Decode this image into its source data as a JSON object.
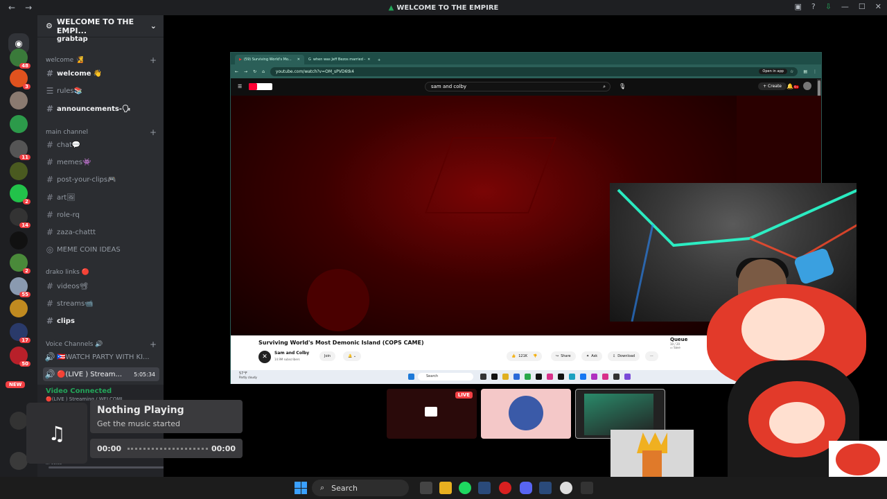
{
  "titlebar": {
    "title": "WELCOME TO THE EMPIRE",
    "back": "←",
    "forward": "→"
  },
  "servers": {
    "badges": [
      "48",
      "3",
      "",
      "",
      "11",
      "",
      "2",
      "14",
      "",
      "2",
      "55",
      "",
      "17",
      "50"
    ],
    "new_label": "NEW"
  },
  "guild": {
    "name": "WELCOME TO THE EMPI...",
    "partial_channel": "grabtap",
    "categories": {
      "welcome": "welcome 🧏",
      "main": "main channel",
      "drako": "drako links 🔴",
      "voice": "Voice Channels 🔊"
    },
    "channels": {
      "welcome": "welcome 👋",
      "rules": "rules📚",
      "announcements": "announcements-🗣",
      "chat": "chat💬",
      "memes": "memes👾",
      "clips": "post-your-clips🎮",
      "art": "art🖼",
      "role": "role-rq",
      "zaza": "zaza-chattt",
      "meme_coin": "MEME COIN IDEAS",
      "videos": "videos📽",
      "streams": "streams📹",
      "clips2": "clips"
    },
    "voice": {
      "watch_party": "🇵🇷WATCH PARTY WITH KI...",
      "live_stream": "🔴(LIVE ) Stream...",
      "timer": "5:05:34"
    }
  },
  "voice_panel": {
    "status": "Video Connected",
    "sub": "🔴(LIVE ) Streaming / WELCOME",
    "in_voice": "In voice"
  },
  "browser": {
    "tab1": "(59) Surviving World's Mo...",
    "tab2": "when was Jeff Bezos married -",
    "url": "youtube.com/watch?v=OM_sPVD6tk4",
    "open_in_app": "Open in app"
  },
  "youtube": {
    "search": "sam and colby",
    "create": "+ Create",
    "notif": "9+",
    "video_title": "Surviving World's Most Demonic Island (COPS CAME)",
    "channel": "Sam and Colby",
    "subs": "14.9M subscribers",
    "join": "Join",
    "likes": "121K",
    "share": "Share",
    "ask": "Ask",
    "download": "Download",
    "queue": "Queue",
    "queue_sub": "10 / 20",
    "save": "Save"
  },
  "mini_taskbar": {
    "weather": "57°F",
    "weather_sub": "Partly cloudy",
    "search": "Search"
  },
  "stream_tiles": {
    "live": "LIVE"
  },
  "player": {
    "title": "Nothing Playing",
    "subtitle": "Get the music started",
    "time_start": "00:00",
    "time_end": "00:00",
    "icon": "♫"
  },
  "taskbar": {
    "search": "Search"
  }
}
